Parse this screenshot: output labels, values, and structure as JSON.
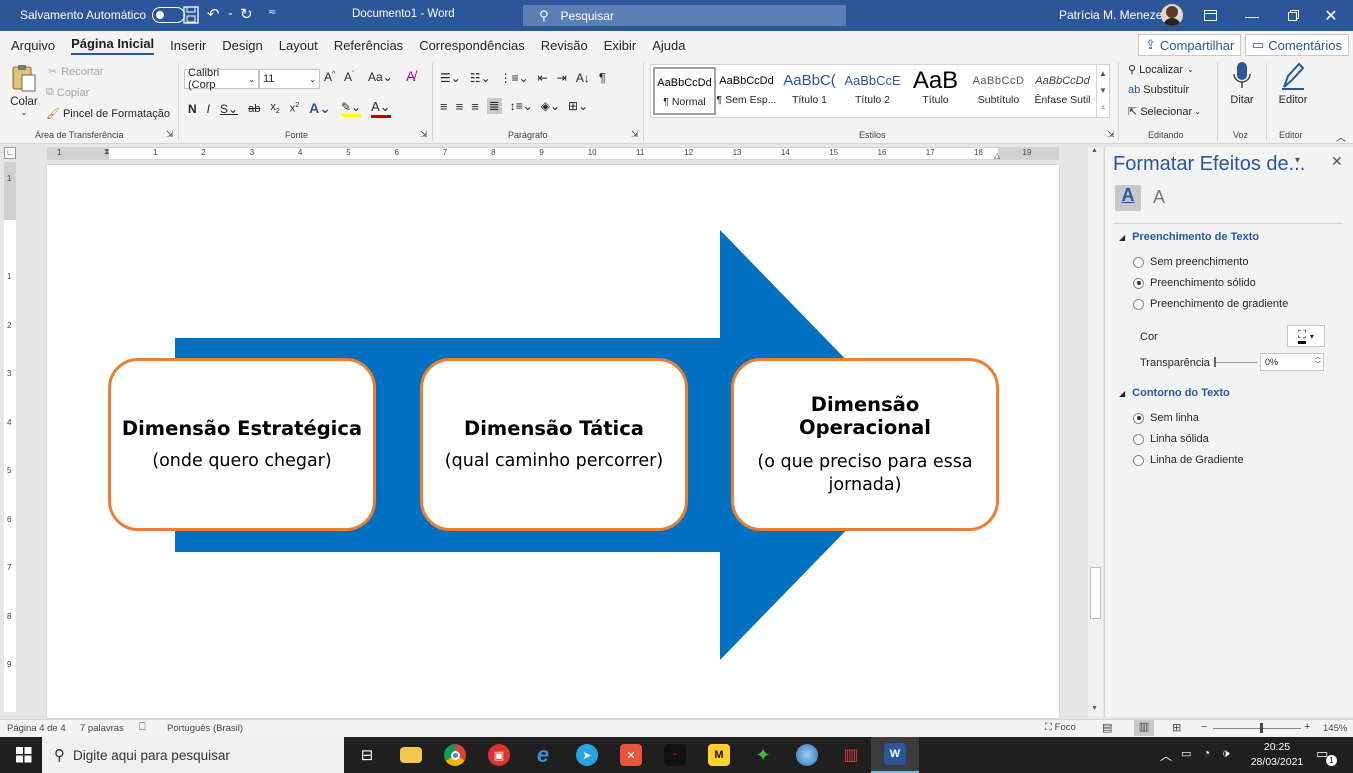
{
  "titlebar": {
    "autosave_label": "Salvamento Automático",
    "document_title": "Documento1  -  Word",
    "search_placeholder": "Pesquisar",
    "user_name": "Patrícia M. Menezes"
  },
  "menu": {
    "items": [
      "Arquivo",
      "Página Inicial",
      "Inserir",
      "Design",
      "Layout",
      "Referências",
      "Correspondências",
      "Revisão",
      "Exibir",
      "Ajuda"
    ],
    "share_label": "Compartilhar",
    "comments_label": "Comentários"
  },
  "ribbon": {
    "clipboard": {
      "paste": "Colar",
      "cut": "Recortar",
      "copy": "Copiar",
      "format_painter": "Pincel de Formatação",
      "group": "Área de Transferência"
    },
    "font": {
      "name": "Calibri (Corp",
      "size": "11",
      "group": "Fonte"
    },
    "paragraph": {
      "group": "Parágrafo"
    },
    "styles": {
      "group": "Estilos",
      "items": [
        {
          "preview": "AaBbCcDd",
          "name": "¶ Normal"
        },
        {
          "preview": "AaBbCcDd",
          "name": "¶ Sem Esp..."
        },
        {
          "preview": "AaBbC(",
          "name": "Título 1"
        },
        {
          "preview": "AaBbCcE",
          "name": "Título 2"
        },
        {
          "preview": "AaB",
          "name": "Título"
        },
        {
          "preview": "AaBbCcD",
          "name": "Subtítulo"
        },
        {
          "preview": "AaBbCcDd",
          "name": "Ênfase Sutil"
        }
      ]
    },
    "editing": {
      "find": "Localizar",
      "replace": "Substituir",
      "select": "Selecionar",
      "group": "Editando"
    },
    "voice": {
      "dictate": "Ditar",
      "group": "Voz"
    },
    "editor": {
      "editor": "Editor",
      "group": "Editor"
    }
  },
  "ruler": {
    "numbers": [
      "1",
      "1",
      "2",
      "3",
      "4",
      "5",
      "6",
      "7",
      "8",
      "9",
      "10",
      "11",
      "12",
      "13",
      "14",
      "15",
      "16",
      "17",
      "18",
      "19"
    ],
    "vnumbers": [
      "1",
      "1",
      "2",
      "3",
      "4",
      "5",
      "6",
      "7",
      "8",
      "9"
    ]
  },
  "diagram": {
    "boxes": [
      {
        "title": "Dimensão Estratégica",
        "subtitle": "(onde quero chegar)"
      },
      {
        "title": "Dimensão Tática",
        "subtitle": "(qual caminho percorrer)"
      },
      {
        "title": "Dimensão Operacional",
        "subtitle": "(o que preciso para essa jornada)"
      }
    ]
  },
  "pane": {
    "title": "Formatar Efeitos de...",
    "fill_section": "Preenchimento de Texto",
    "fill_options": [
      "Sem preenchimento",
      "Preenchimento sólido",
      "Preenchimento de gradiente"
    ],
    "color_label": "Cor",
    "transparency_label": "Transparência",
    "transparency_value": "0%",
    "outline_section": "Contorno do Texto",
    "outline_options": [
      "Sem linha",
      "Linha sólida",
      "Linha de Gradiente"
    ]
  },
  "status": {
    "page": "Página 4 de 4",
    "words": "7 palavras",
    "language": "Português (Brasil)",
    "focus": "Foco",
    "zoom": "145%"
  },
  "taskbar": {
    "search_placeholder": "Digite aqui para pesquisar",
    "time": "20:25",
    "date": "28/03/2021",
    "notifications": "1"
  },
  "colors": {
    "accent": "#2b579a",
    "arrow": "#0070c0",
    "box_border": "#ed7d31"
  }
}
